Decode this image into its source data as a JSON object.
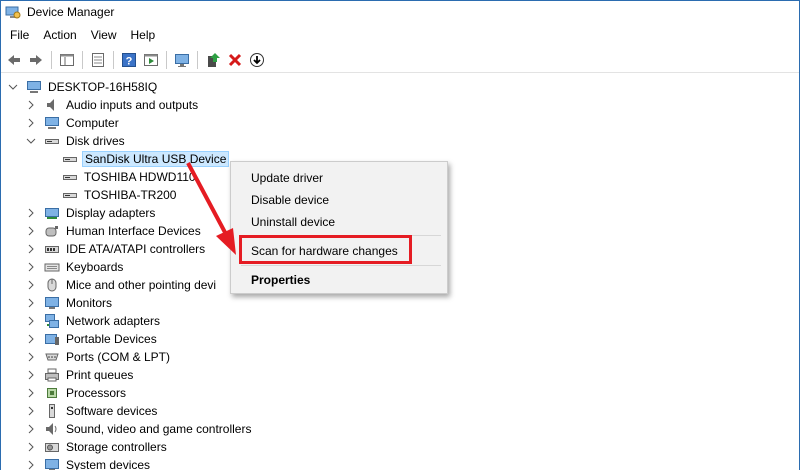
{
  "window": {
    "title": "Device Manager"
  },
  "menubar": {
    "items": [
      "File",
      "Action",
      "View",
      "Help"
    ]
  },
  "toolbar": {
    "buttons": [
      "back-arrow-icon",
      "forward-arrow-icon",
      "show-hide-tree-icon",
      "properties-icon",
      "help-icon",
      "run-icon",
      "monitor-scan-icon",
      "update-driver-icon",
      "uninstall-red-x-icon",
      "download-icon"
    ]
  },
  "tree": {
    "root": "DESKTOP-16H58IQ",
    "categories": [
      {
        "label": "Audio inputs and outputs"
      },
      {
        "label": "Computer"
      },
      {
        "label": "Disk drives",
        "expanded": true,
        "children": [
          "SanDisk Ultra USB Device",
          "TOSHIBA HDWD110",
          "TOSHIBA-TR200"
        ]
      },
      {
        "label": "Display adapters"
      },
      {
        "label": "Human Interface Devices"
      },
      {
        "label": "IDE ATA/ATAPI controllers"
      },
      {
        "label": "Keyboards"
      },
      {
        "label": "Mice and other pointing devi"
      },
      {
        "label": "Monitors"
      },
      {
        "label": "Network adapters"
      },
      {
        "label": "Portable Devices"
      },
      {
        "label": "Ports (COM & LPT)"
      },
      {
        "label": "Print queues"
      },
      {
        "label": "Processors"
      },
      {
        "label": "Software devices"
      },
      {
        "label": "Sound, video and game controllers"
      },
      {
        "label": "Storage controllers"
      },
      {
        "label": "System devices"
      }
    ]
  },
  "context_menu": {
    "items": [
      "Update driver",
      "Disable device",
      "Uninstall device",
      "Scan for hardware changes",
      "Properties"
    ]
  },
  "colors": {
    "highlight_red": "#e51c23",
    "selection": "#cce8ff"
  }
}
